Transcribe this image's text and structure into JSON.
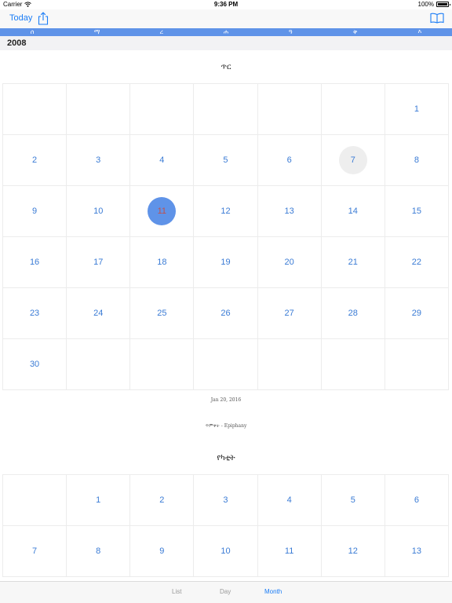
{
  "status_bar": {
    "carrier": "Carrier",
    "time": "9:36 PM",
    "battery": "100%"
  },
  "nav": {
    "today_label": "Today"
  },
  "weekdays": [
    "ሰ",
    "ማ",
    "ረ",
    "ሐ",
    "ዓ",
    "ቅ",
    "እ"
  ],
  "year": "2008",
  "month1": {
    "title": "ጥር",
    "days": [
      "",
      "",
      "",
      "",
      "",
      "",
      "1",
      "2",
      "3",
      "4",
      "5",
      "6",
      "7",
      "8",
      "9",
      "10",
      "11",
      "12",
      "13",
      "14",
      "15",
      "16",
      "17",
      "18",
      "19",
      "20",
      "21",
      "22",
      "23",
      "24",
      "25",
      "26",
      "27",
      "28",
      "29",
      "30",
      "",
      "",
      "",
      "",
      "",
      ""
    ],
    "today_day": "7",
    "selected_day": "11"
  },
  "selected_info": {
    "date": "Jan 20, 2016",
    "holiday": "ጥምቀት - Epiphany"
  },
  "month2": {
    "title": "የካቲት",
    "days": [
      "",
      "1",
      "2",
      "3",
      "4",
      "5",
      "6",
      "7",
      "8",
      "9",
      "10",
      "11",
      "12",
      "13"
    ]
  },
  "tabs": [
    {
      "label": "List",
      "color": "#9a9a9a"
    },
    {
      "label": "Day",
      "color": "#9a9a9a"
    },
    {
      "label": "Month",
      "color": "#1a7cf6"
    }
  ],
  "colors": {
    "accent": "#1a7cf6",
    "weekbar": "#5f93e8",
    "day_text": "#3a7bd5"
  }
}
